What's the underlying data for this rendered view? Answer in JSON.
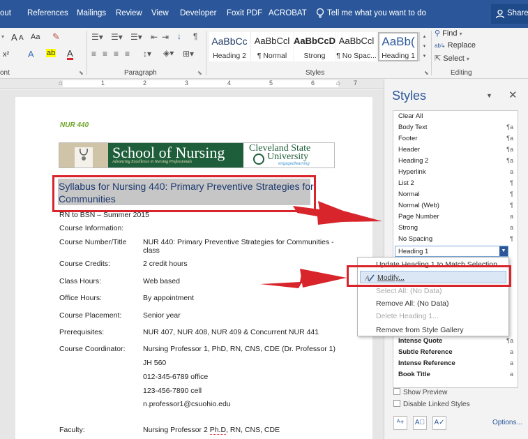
{
  "menu": {
    "items": [
      "out",
      "References",
      "Mailings",
      "Review",
      "View",
      "Developer",
      "Foxit PDF",
      "ACROBAT"
    ],
    "tell_me": "Tell me what you want to do",
    "share": "Share"
  },
  "ribbon": {
    "font_group_label": "ont",
    "font_grow": "A",
    "font_shrink": "A",
    "change_case": "Aa",
    "superscript": "x²",
    "paragraph_group_label": "Paragraph",
    "sort_icon": "↓",
    "pilcrow": "¶",
    "styles_group_label": "Styles",
    "style_tiles": [
      {
        "sample": "AaBbCc",
        "name": "Heading 2"
      },
      {
        "sample": "AaBbCcl",
        "name": "¶ Normal"
      },
      {
        "sample": "AaBbCcD",
        "name": "Strong"
      },
      {
        "sample": "AaBbCcl",
        "name": "¶ No Spac..."
      },
      {
        "sample": "AaBb(",
        "name": "Heading 1"
      }
    ],
    "editing_group_label": "Editing",
    "find": "Find",
    "replace": "Replace",
    "select": "Select"
  },
  "ruler": {
    "numbers": [
      "1",
      "2",
      "3",
      "4",
      "5",
      "6",
      "7"
    ]
  },
  "document": {
    "course_code": "NUR 440",
    "banner": {
      "title": "School of Nursing",
      "tagline": "Advancing Excellence in Nursing Professionals",
      "university_line1": "Cleveland State",
      "university_line2": "University",
      "engaged": "engagedlearning"
    },
    "heading_line1": "Syllabus for Nursing 440: Primary Preventive Strategies for",
    "heading_line2": "Communities",
    "subtitle": "RN to BSN – Summer 2015",
    "course_info": "Course Information:",
    "rows": [
      {
        "label": "Course Number/Title",
        "value": "NUR 440: Primary Preventive Strategies for Communities -",
        "value2": "class"
      },
      {
        "label": "Course Credits:",
        "value": "2 credit hours"
      },
      {
        "label": "Class Hours:",
        "value": "Web based"
      },
      {
        "label": "Office Hours:",
        "value": "By appointment"
      },
      {
        "label": "Course Placement:",
        "value": "Senior year"
      },
      {
        "label": "Prerequisites:",
        "value": "NUR 407, NUR 408, NUR 409 & Concurrent NUR 441"
      },
      {
        "label": "Course Coordinator:",
        "value": "Nursing Professor 1, PhD, RN, CNS, CDE (Dr. Professor 1)"
      }
    ],
    "coordinator_extra": [
      "JH 560",
      "012-345-6789 office",
      "123-456-7890 cell",
      "n.professor1@csuohio.edu"
    ],
    "faculty_label": "Faculty:",
    "faculty_value_a": "Nursing Professor 2 ",
    "faculty_value_b": "Ph.D",
    "faculty_value_c": ", RN, CNS, CDE"
  },
  "styles_pane": {
    "title": "Styles",
    "items": [
      {
        "name": "Clear All",
        "mark": ""
      },
      {
        "name": "Body Text",
        "mark": "¶a"
      },
      {
        "name": "Footer",
        "mark": "¶a"
      },
      {
        "name": "Header",
        "mark": "¶a"
      },
      {
        "name": "Heading 2",
        "mark": "¶a"
      },
      {
        "name": "Hyperlink",
        "mark": "a"
      },
      {
        "name": "List 2",
        "mark": "¶"
      },
      {
        "name": "Normal",
        "mark": "¶"
      },
      {
        "name": "Normal (Web)",
        "mark": "¶"
      },
      {
        "name": "Page Number",
        "mark": "a"
      },
      {
        "name": "Strong",
        "mark": "a"
      },
      {
        "name": "No Spacing",
        "mark": "¶"
      },
      {
        "name": "Heading 1",
        "mark": ""
      }
    ],
    "lower_items": [
      {
        "name": "Intense Quote",
        "mark": "¶a"
      },
      {
        "name": "Subtle Reference",
        "mark": "a"
      },
      {
        "name": "Intense Reference",
        "mark": "a"
      },
      {
        "name": "Book Title",
        "mark": "a"
      }
    ],
    "show_preview": "Show Preview",
    "disable_linked": "Disable Linked Styles",
    "options": "Options..."
  },
  "context_menu": {
    "items": [
      "Update Heading 1 to Match Selection",
      "Modify...",
      "Select All: (No Data)",
      "Remove All: (No Data)",
      "Delete Heading 1...",
      "Remove from Style Gallery"
    ]
  },
  "colors": {
    "accent": "#2b579a",
    "highlight_red": "#d8242b",
    "nursing_green": "#1f5e3a"
  }
}
